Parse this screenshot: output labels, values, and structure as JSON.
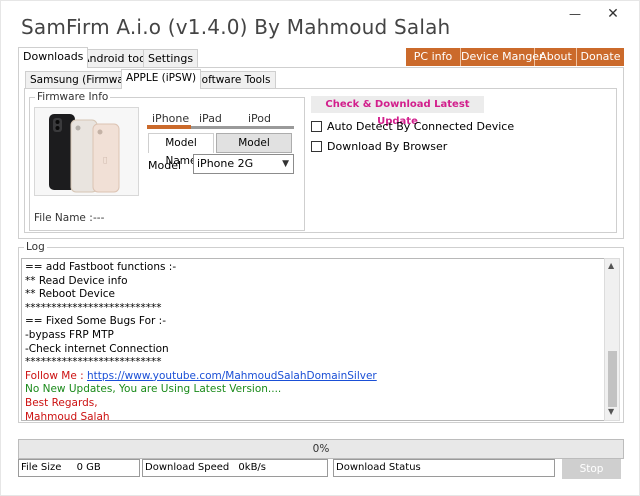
{
  "window": {
    "title": "SamFirm A.i.o (v1.4.0) By Mahmoud Salah",
    "minimize_glyph": "—",
    "close_glyph": "✕"
  },
  "main_tabs": [
    "Downloads",
    "Android tools",
    "Settings"
  ],
  "menu_bar": [
    "PC info",
    "Device Manger",
    "About",
    "Donate"
  ],
  "sub_tabs": [
    "Samsung (Firmware)",
    "APPLE (iPSW)",
    "Software Tools"
  ],
  "firmware": {
    "legend": "Firmware Info",
    "device_tabs": [
      "iPhone",
      "iPad",
      "iPod"
    ],
    "model_tabs": [
      "Model Name",
      "Model Number"
    ],
    "model_label": "Model",
    "model_value": "iPhone 2G",
    "file_name_label": "File Name :",
    "file_name_value": "---"
  },
  "actions": {
    "check_download": "Check & Download Latest Update",
    "auto_detect": "Auto Detect By Connected Device",
    "download_browser": "Download By Browser"
  },
  "log": {
    "legend": "Log",
    "lines": [
      {
        "text": "== add Fastboot functions :-",
        "color": "#000000"
      },
      {
        "text": "** Read Device info",
        "color": "#000000"
      },
      {
        "text": "** Reboot Device",
        "color": "#000000"
      },
      {
        "text": "**************************",
        "color": "#000000"
      },
      {
        "text": "== Fixed Some Bugs For :-",
        "color": "#000000"
      },
      {
        "text": "-bypass FRP MTP",
        "color": "#000000"
      },
      {
        "text": "-Check internet Connection",
        "color": "#000000"
      },
      {
        "text": "**************************",
        "color": "#000000"
      },
      {
        "text": "Follow Me : ",
        "color": "#cc1111",
        "link": "https://www.youtube.com/MahmoudSalahDomainSilver"
      },
      {
        "text": "No New Updates, You are Using Latest Version....",
        "color": "#1a8a1a"
      },
      {
        "text": "Best Regards,",
        "color": "#cc1111"
      },
      {
        "text": "Mahmoud Salah",
        "color": "#cc1111"
      }
    ]
  },
  "progress": {
    "label": "0%",
    "value": 0
  },
  "status": {
    "file_size_label": "File Size",
    "file_size_value": "0 GB",
    "speed_label": "Download Speed",
    "speed_value": "0kB/s",
    "status_label": "Download Status",
    "stop_label": "Stop"
  },
  "colors": {
    "accent_orange": "#cb6a2b",
    "check_button_text": "#d21f8c",
    "log_green": "#1a8a1a",
    "log_red": "#cc1111",
    "link_blue": "#1a4fd6"
  }
}
